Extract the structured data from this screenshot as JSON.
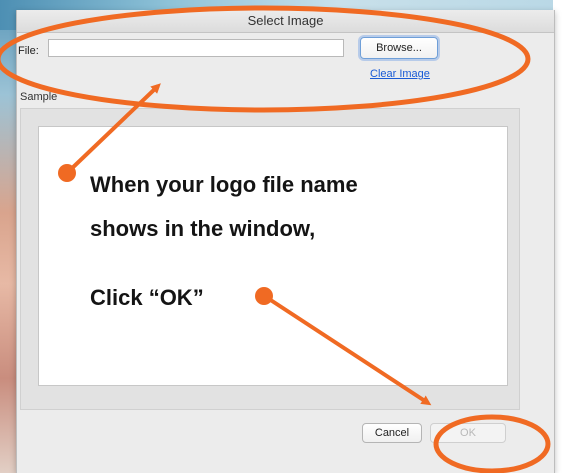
{
  "dialog": {
    "title": "Select Image",
    "file_label": "File:",
    "file_value": "",
    "browse_label": "Browse...",
    "clear_label": "Clear Image",
    "sample_label": "Sample",
    "cancel_label": "Cancel",
    "ok_label": "OK"
  },
  "annotation": {
    "line1": "When your logo file name",
    "line2": "shows in the window,",
    "line3": "Click “OK”",
    "color": "#f06a23"
  }
}
